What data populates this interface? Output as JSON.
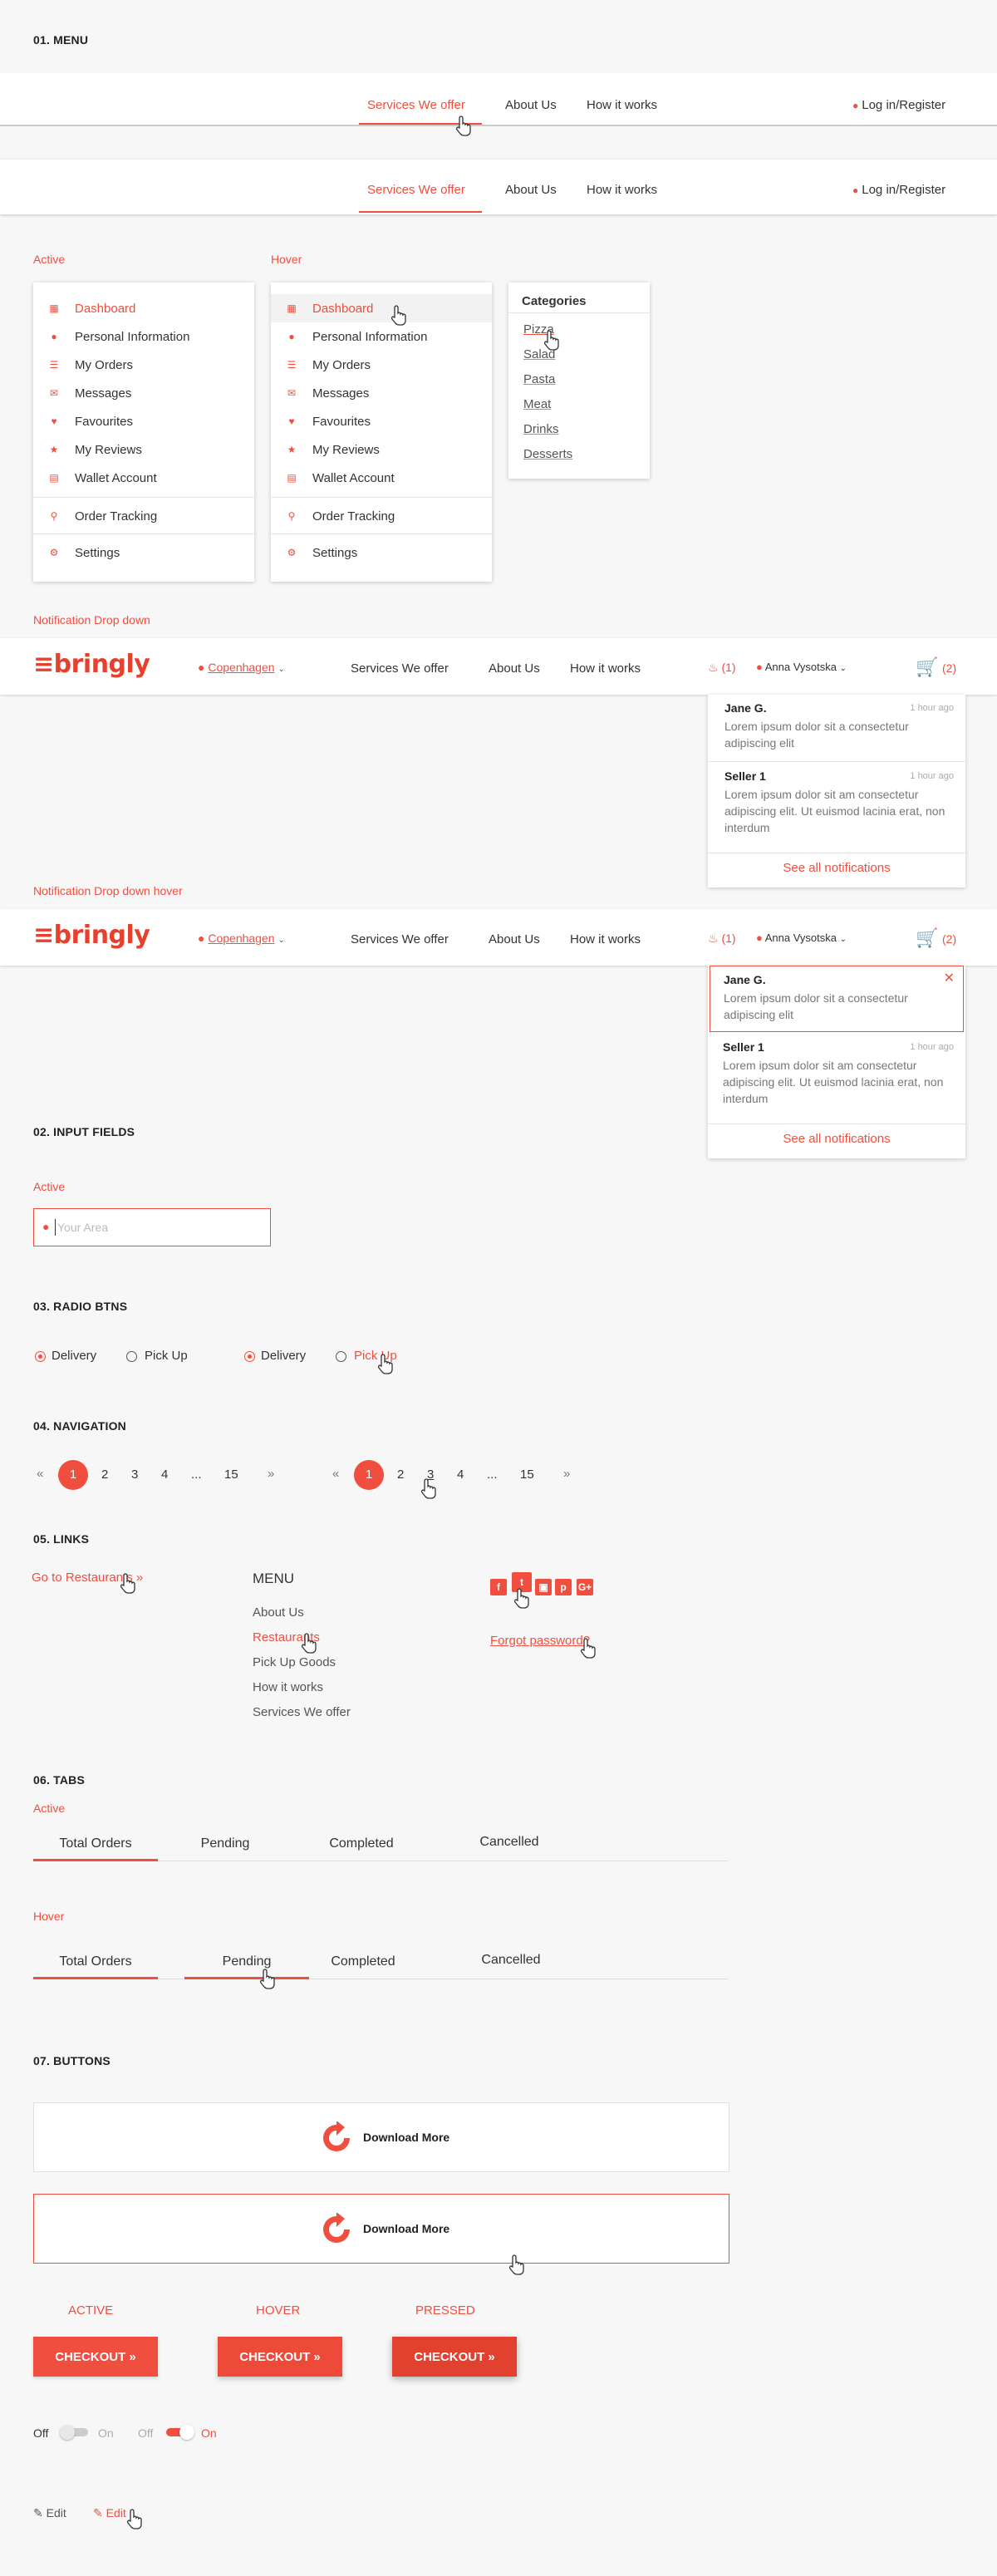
{
  "sections": {
    "menu": "01. MENU",
    "input": "02. INPUT FIELDS",
    "radio": "03. RADIO BTNS",
    "nav": "04. NAVIGATION",
    "links": "05. LINKS",
    "tabs": "06. TABS",
    "buttons": "07. BUTTONS"
  },
  "topnav": {
    "services": "Services  We offer",
    "about": "About Us",
    "how": "How it works",
    "login": "Log in/Register"
  },
  "states": {
    "active": "Active",
    "hover": "Hover",
    "notif_dd": "Notification Drop down",
    "notif_dd_hover": "Notification Drop down hover"
  },
  "user_menu": {
    "items": [
      "Dashboard",
      "Personal Information",
      "My Orders",
      "Messages",
      "Favourites",
      "My Reviews",
      "Wallet Account"
    ],
    "tracking": "Order Tracking",
    "settings": "Settings"
  },
  "categories": {
    "title": "Categories",
    "items": [
      "Pizza",
      "Salad",
      "Pasta",
      "Meat",
      "Drinks",
      "Desserts"
    ]
  },
  "header2": {
    "logo": "bringly",
    "city": "Copenhagen",
    "services": "Services  We offer",
    "about": "About Us",
    "how": "How it works",
    "notif_count": "(1)",
    "user": "Anna Vysotska",
    "cart_count": "(2)"
  },
  "notifications": {
    "items": [
      {
        "name": "Jane G.",
        "time": "1 hour ago",
        "text": "Lorem ipsum dolor sit a consectetur adipiscing elit"
      },
      {
        "name": "Seller 1",
        "time": "1 hour ago",
        "text": "Lorem ipsum dolor sit am consectetur adipiscing elit. Ut euismod lacinia erat, non interdum"
      }
    ],
    "see_all": "See all notifications"
  },
  "input": {
    "label": "Active",
    "placeholder": "Your Area"
  },
  "radio": {
    "delivery": "Delivery",
    "pickup": "Pick Up"
  },
  "pagination": {
    "prev": "«",
    "next": "»",
    "pages": [
      "1",
      "2",
      "3",
      "4",
      "...",
      "15"
    ]
  },
  "links": {
    "restaurants": "Go to Restaurants  »",
    "menu_title": "MENU",
    "menu_items": [
      "About Us",
      "Restaurants",
      "Pick Up Goods",
      "How it works",
      "Services We offer"
    ],
    "forgot": "Forgot password?"
  },
  "tabs": {
    "active_label": "Active",
    "hover_label": "Hover",
    "items": [
      "Total Orders",
      "Pending",
      "Completed",
      "Cancelled"
    ]
  },
  "buttons": {
    "download": "Download More",
    "active": "ACTIVE",
    "hover": "HOVER",
    "pressed": "PRESSED",
    "checkout": "CHECKOUT  »",
    "off": "Off",
    "on": "On",
    "edit": "Edit"
  },
  "colors": {
    "accent": "#f04e3e",
    "text": "#333333",
    "muted": "#777777",
    "background": "#f7f7f7"
  }
}
